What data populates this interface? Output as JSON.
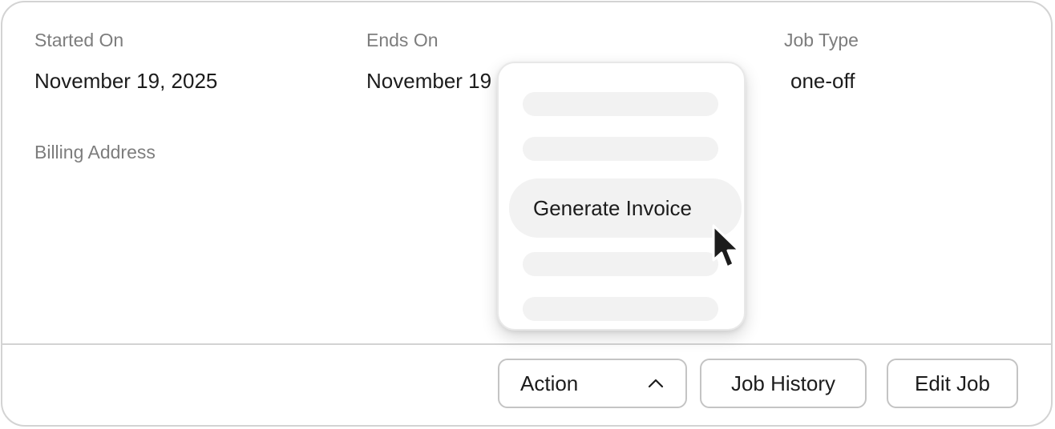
{
  "details": {
    "started_on_label": "Started On",
    "started_on_value": "November 19, 2025",
    "ends_on_label": "Ends On",
    "ends_on_value": "November 19",
    "job_type_label": "Job Type",
    "job_type_value": "one-off",
    "billing_address_label": "Billing Address"
  },
  "action_menu": {
    "highlighted_item": "Generate Invoice",
    "placeholder_items": 4
  },
  "footer": {
    "action_label": "Action",
    "job_history_label": "Job History",
    "edit_job_label": "Edit Job"
  },
  "icons": {
    "action_chevron": "chevron-up-icon",
    "cursor": "mouse-pointer-icon"
  },
  "colors": {
    "border": "#d3d3d3",
    "label_text": "#7d7d7d",
    "value_text": "#1c1c1c",
    "menu_item_bg": "#f2f2f2"
  }
}
